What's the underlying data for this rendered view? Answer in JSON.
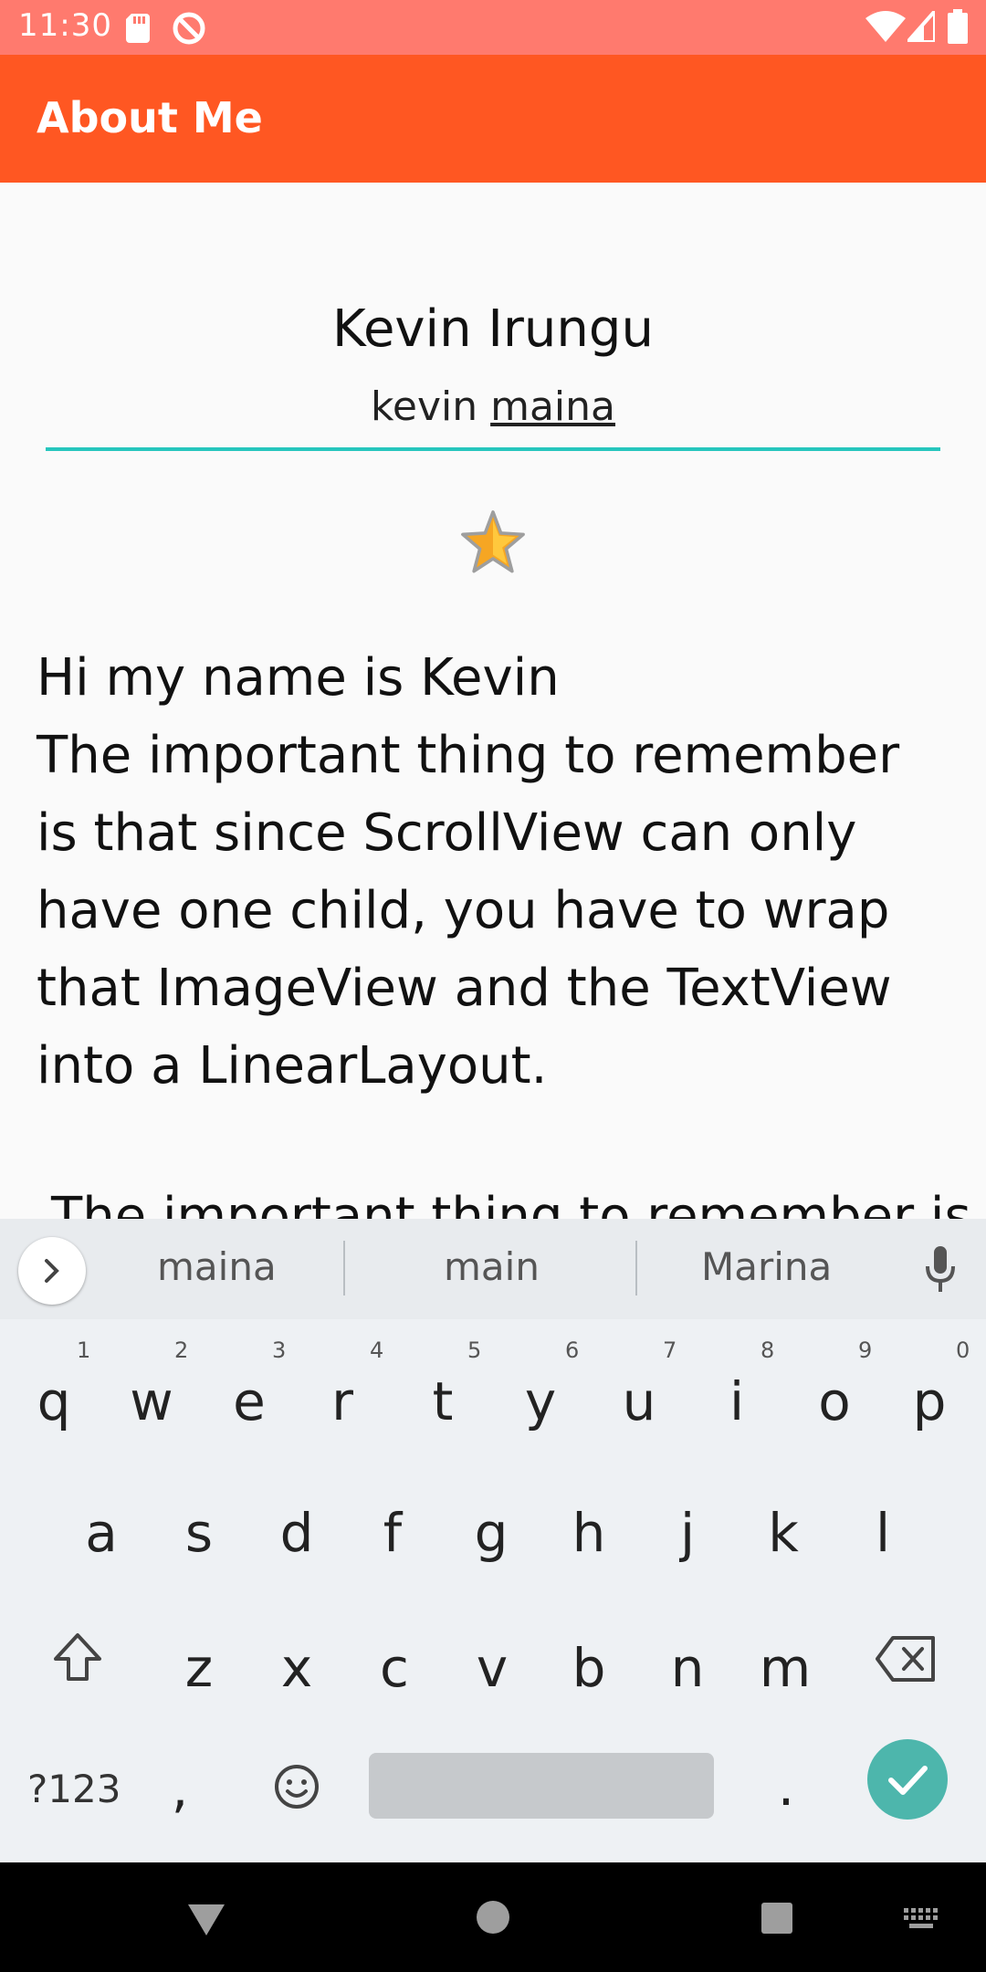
{
  "status": {
    "time": "11:30",
    "icons": [
      "sd-card-icon",
      "no-sync-icon",
      "wifi-icon",
      "signal-icon",
      "battery-icon"
    ]
  },
  "appbar": {
    "title": "About Me"
  },
  "profile": {
    "name": "Kevin Irungu",
    "nickname_first": "kevin",
    "nickname_second": "maina",
    "bio": "Hi my name is Kevin\nThe important thing to remember is that since ScrollView can only have one child, you have to wrap that ImageView and the TextView into a LinearLayout.",
    "bio_continued": "The important thing to remember is"
  },
  "keyboard": {
    "suggestions": [
      "maina",
      "main",
      "Marina"
    ],
    "row1": [
      "q",
      "w",
      "e",
      "r",
      "t",
      "y",
      "u",
      "i",
      "o",
      "p"
    ],
    "row1_hints": [
      "1",
      "2",
      "3",
      "4",
      "5",
      "6",
      "7",
      "8",
      "9",
      "0"
    ],
    "row2": [
      "a",
      "s",
      "d",
      "f",
      "g",
      "h",
      "j",
      "k",
      "l"
    ],
    "row3": [
      "z",
      "x",
      "c",
      "v",
      "b",
      "n",
      "m"
    ],
    "symbols_label": "?123",
    "comma": ",",
    "period": "."
  },
  "colors": {
    "accent": "#ff5722",
    "status": "#ff7a6e",
    "underline": "#26c6bd",
    "enter": "#4db6ac"
  }
}
